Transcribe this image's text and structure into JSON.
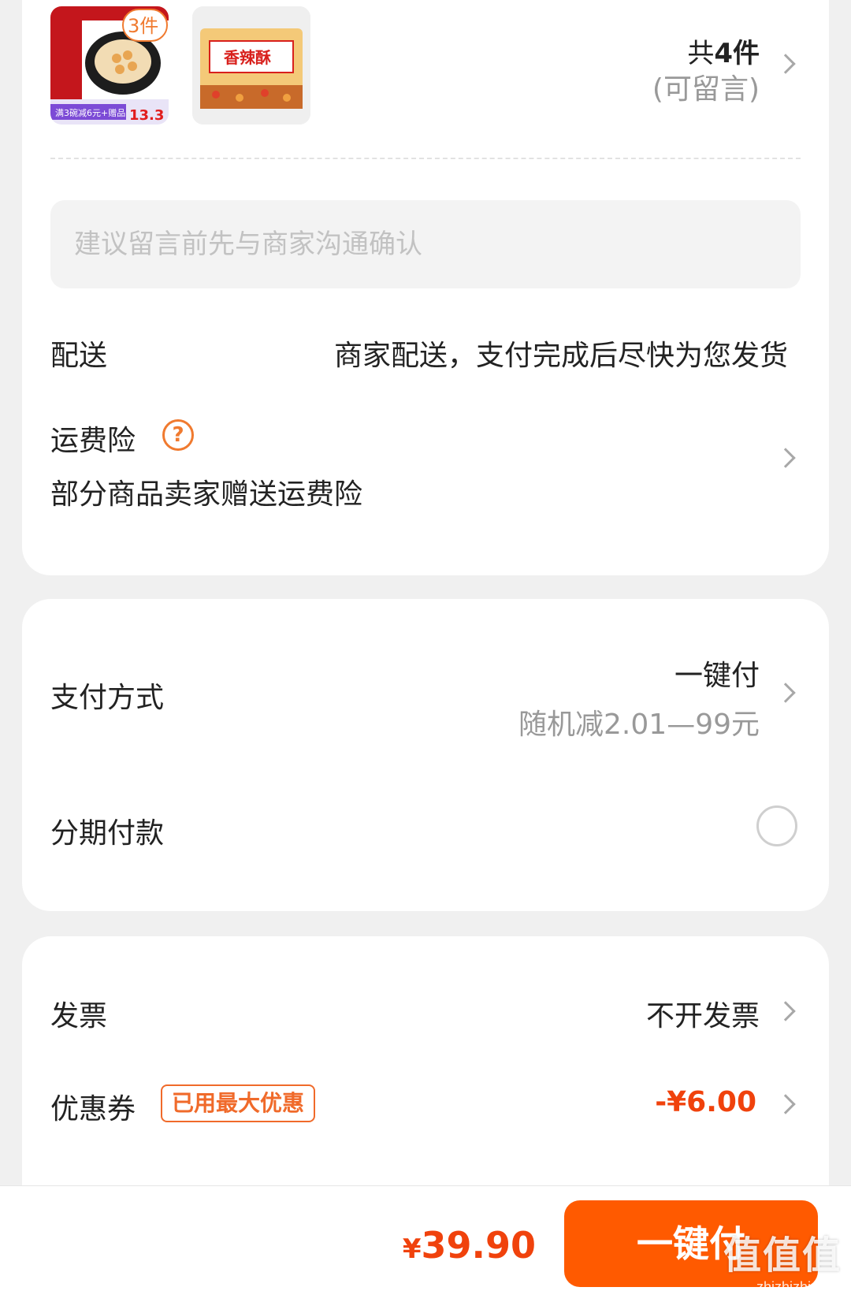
{
  "order": {
    "badge": "3件",
    "count_prefix": "共",
    "count_num": "4件",
    "note_hint": "(可留言)",
    "thumb1_tag": "满3碗减6元+赠品",
    "thumb1_price": "13.3",
    "thumb2_label": "香辣酥",
    "note_placeholder": "建议留言前先与商家沟通确认",
    "delivery_label": "配送",
    "delivery_value": "商家配送，支付完成后尽快为您发货",
    "insurance_label": "运费险",
    "insurance_value": "部分商品卖家赠送运费险"
  },
  "payment": {
    "method_label": "支付方式",
    "method_value": "一键付",
    "method_promo": "随机减2.01—99元",
    "installment_label": "分期付款"
  },
  "extras": {
    "invoice_label": "发票",
    "invoice_value": "不开发票",
    "coupon_label": "优惠券",
    "coupon_tag": "已用最大优惠",
    "coupon_value": "-¥6.00"
  },
  "footer": {
    "currency": "¥",
    "total": "39.90",
    "pay_button": "一键付"
  },
  "watermark": {
    "big": "值值值",
    "small": "zhizhizhi.com"
  },
  "colors": {
    "accent": "#ff5a00",
    "price": "#f0420c",
    "help": "#f07a2f"
  },
  "icons": [
    "chevron-right-icon",
    "help-circle-icon",
    "radio-unchecked-icon"
  ]
}
